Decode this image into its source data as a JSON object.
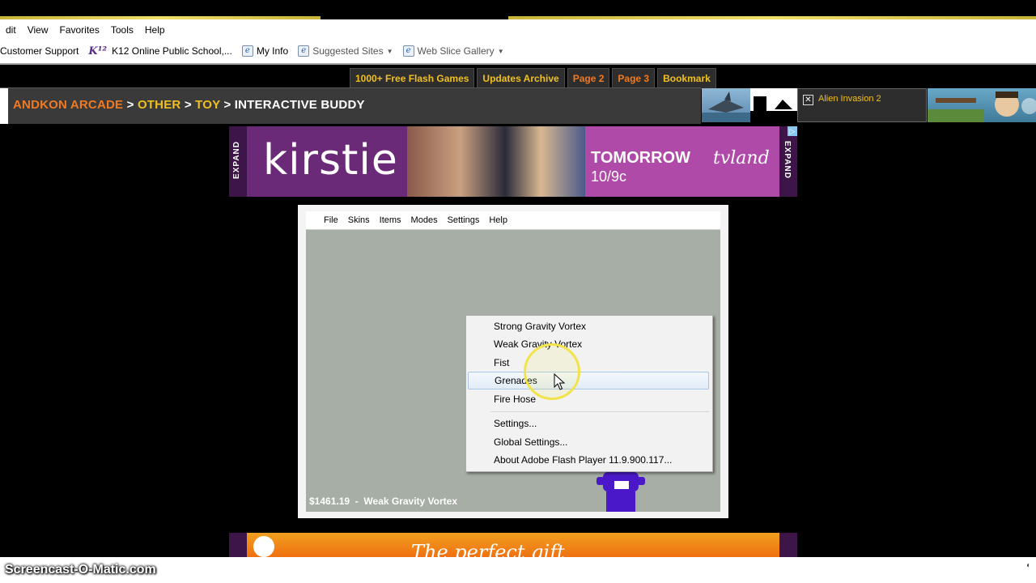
{
  "browser": {
    "menu": [
      "dit",
      "View",
      "Favorites",
      "Tools",
      "Help"
    ],
    "favorites": [
      {
        "label": "Customer Support",
        "icon": "none",
        "dropdown": false
      },
      {
        "label": "K12  Online Public School,...",
        "icon": "k12-logo-icon",
        "dropdown": false
      },
      {
        "label": "My Info",
        "icon": "ie-page-icon",
        "dropdown": false
      },
      {
        "label": "Suggested Sites",
        "icon": "ie-page-icon",
        "dropdown": true
      },
      {
        "label": "Web Slice Gallery",
        "icon": "ie-page-icon",
        "dropdown": true
      }
    ]
  },
  "site_nav": {
    "tabs": [
      "1000+ Free Flash Games",
      "Updates Archive",
      "Page 2",
      "Page 3",
      "Bookmark"
    ]
  },
  "breadcrumb": {
    "site": "ANDKON ARCADE",
    "separator": ">",
    "category": "OTHER",
    "subcategory": "TOY",
    "current": "INTERACTIVE BUDDY"
  },
  "popup": {
    "title": "Alien Invasion 2"
  },
  "ad_top": {
    "expand_label": "EXPAND",
    "brand": "kirstie",
    "headline": "TOMORROW",
    "date": "10/9c",
    "network": "tvland"
  },
  "ad_bottom": {
    "tagline": "The perfect gift"
  },
  "game": {
    "menu": [
      "File",
      "Skins",
      "Items",
      "Modes",
      "Settings",
      "Help"
    ],
    "money": "$1461.19",
    "status_sep": "-",
    "status_item": "Weak Gravity Vortex"
  },
  "context_menu": {
    "items": [
      "Strong Gravity Vortex",
      "Weak Gravity Vortex",
      "Fist",
      "Grenades",
      "Fire Hose"
    ],
    "hovered_index": 3,
    "settings": [
      "Settings...",
      "Global Settings...",
      "About Adobe Flash Player 11.9.900.117..."
    ]
  },
  "watermark": "Screencast-O-Matic.com",
  "colors": {
    "site_orange": "#f07a20",
    "site_yellow": "#f0c020",
    "buddy_purple": "#4a18c8",
    "game_bg": "#a7aea5"
  }
}
